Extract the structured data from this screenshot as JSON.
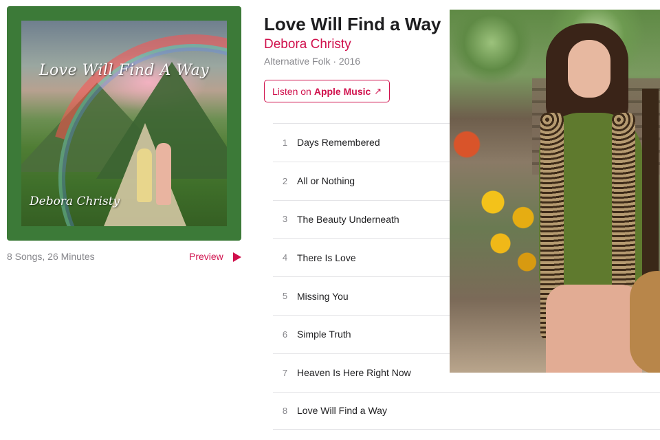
{
  "album": {
    "title": "Love Will Find a Way",
    "artist": "Debora Christy",
    "genre_year": "Alternative Folk · 2016",
    "summary": "8 Songs, 26 Minutes"
  },
  "artwork": {
    "title_text": "Love Will Find A Way",
    "artist_text": "Debora Christy"
  },
  "actions": {
    "preview_label": "Preview",
    "listen_prefix": "Listen on",
    "listen_brand": "Apple Music",
    "listen_arrow": "↗"
  },
  "tracks": [
    {
      "num": "1",
      "name": "Days Remembered"
    },
    {
      "num": "2",
      "name": "All or Nothing"
    },
    {
      "num": "3",
      "name": "The Beauty Underneath"
    },
    {
      "num": "4",
      "name": "There Is Love"
    },
    {
      "num": "5",
      "name": "Missing You"
    },
    {
      "num": "6",
      "name": "Simple Truth"
    },
    {
      "num": "7",
      "name": "Heaven Is Here Right Now"
    },
    {
      "num": "8",
      "name": "Love Will Find a Way"
    }
  ],
  "colors": {
    "accent": "#d0104c",
    "artwork_border": "#3c7a38",
    "secondary_text": "#86868b"
  },
  "icons": {
    "preview": "play-icon",
    "listen": "external-arrow-icon"
  }
}
